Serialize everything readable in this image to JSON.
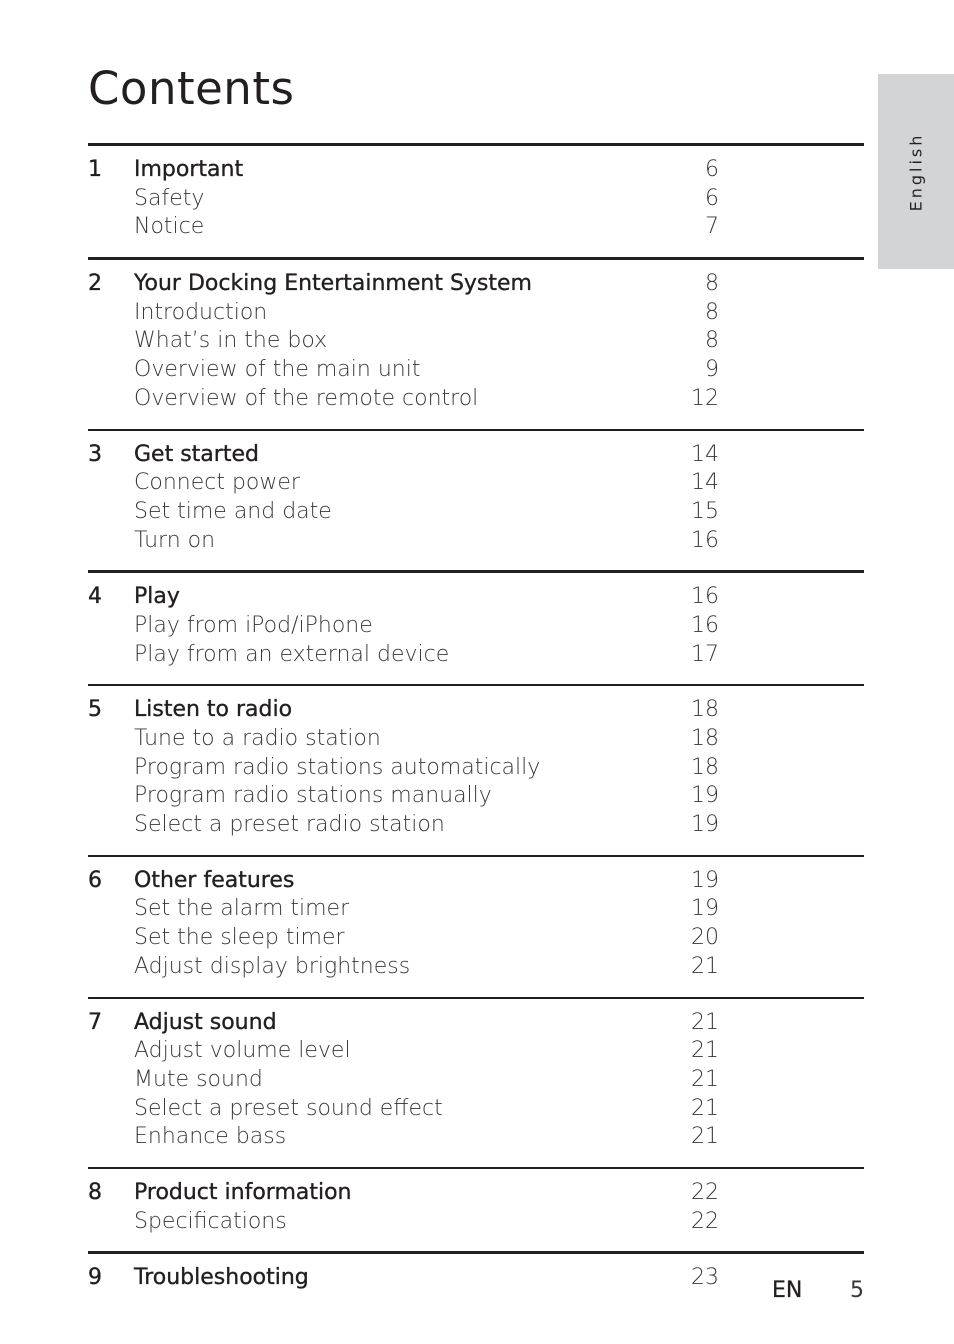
{
  "page": {
    "title": "Contents",
    "language_tab": "English",
    "footer": {
      "language_code": "EN",
      "page_number": "5"
    }
  },
  "toc": [
    {
      "number": "1",
      "title": "Important",
      "page": "6",
      "items": [
        {
          "title": "Safety",
          "page": "6"
        },
        {
          "title": "Notice",
          "page": "7"
        }
      ]
    },
    {
      "number": "2",
      "title": "Your Docking Entertainment System",
      "page": "8",
      "items": [
        {
          "title": "Introduction",
          "page": "8"
        },
        {
          "title": "What’s in the box",
          "page": "8"
        },
        {
          "title": "Overview of the main unit",
          "page": "9"
        },
        {
          "title": "Overview of the remote control",
          "page": "12"
        }
      ]
    },
    {
      "number": "3",
      "title": "Get started",
      "page": "14",
      "items": [
        {
          "title": "Connect power",
          "page": "14"
        },
        {
          "title": "Set time and date",
          "page": "15"
        },
        {
          "title": "Turn on",
          "page": "16"
        }
      ]
    },
    {
      "number": "4",
      "title": "Play",
      "page": "16",
      "items": [
        {
          "title": "Play from iPod/iPhone",
          "page": "16"
        },
        {
          "title": "Play from an external device",
          "page": "17"
        }
      ]
    },
    {
      "number": "5",
      "title": "Listen to radio",
      "page": "18",
      "items": [
        {
          "title": "Tune to a radio station",
          "page": "18"
        },
        {
          "title": "Program radio stations automatically",
          "page": "18"
        },
        {
          "title": "Program radio stations manually",
          "page": "19"
        },
        {
          "title": "Select a preset radio station",
          "page": "19"
        }
      ]
    },
    {
      "number": "6",
      "title": "Other features",
      "page": "19",
      "items": [
        {
          "title": "Set the alarm timer",
          "page": "19"
        },
        {
          "title": "Set the sleep timer",
          "page": "20"
        },
        {
          "title": "Adjust display brightness",
          "page": "21"
        }
      ]
    },
    {
      "number": "7",
      "title": "Adjust sound",
      "page": "21",
      "items": [
        {
          "title": "Adjust volume level",
          "page": "21"
        },
        {
          "title": "Mute sound",
          "page": "21"
        },
        {
          "title": "Select a preset sound effect",
          "page": "21"
        },
        {
          "title": "Enhance bass",
          "page": "21"
        }
      ]
    },
    {
      "number": "8",
      "title": "Product information",
      "page": "22",
      "items": [
        {
          "title": "Specifications",
          "page": "22"
        }
      ]
    },
    {
      "number": "9",
      "title": "Troubleshooting",
      "page": "23",
      "items": []
    }
  ]
}
